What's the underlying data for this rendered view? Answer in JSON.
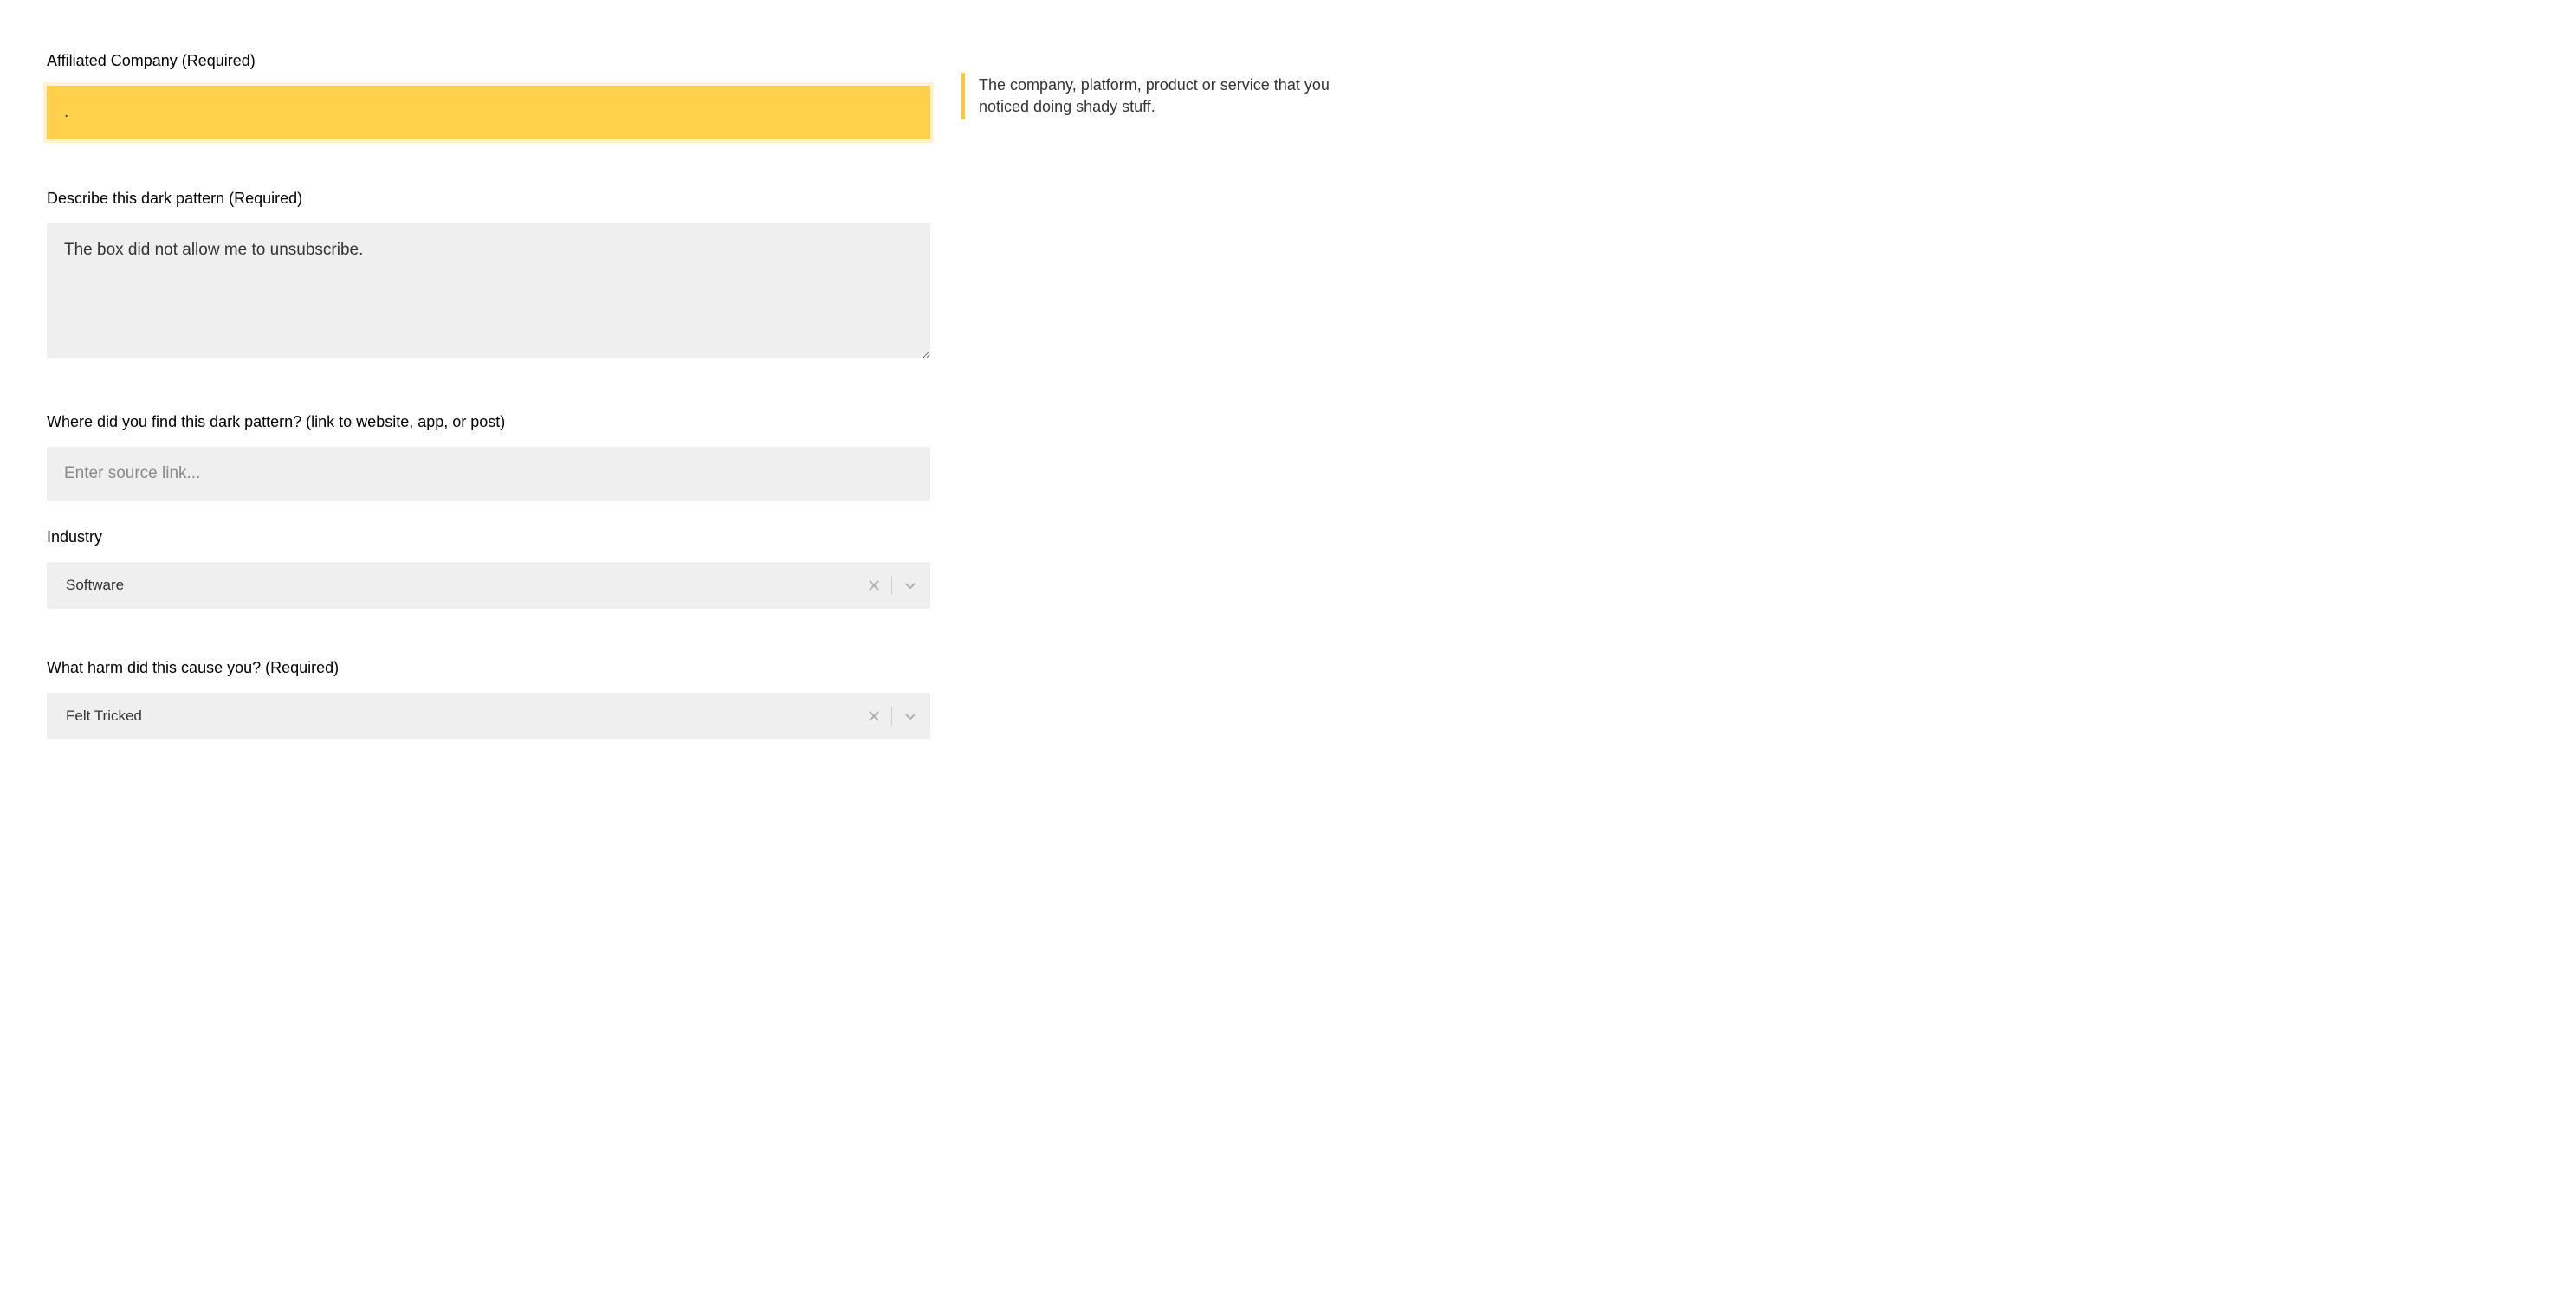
{
  "fields": {
    "company": {
      "label": "Affiliated Company (Required)",
      "value": ".",
      "help": "The company, platform, product or service that you noticed doing shady stuff."
    },
    "description": {
      "label": "Describe this dark pattern (Required)",
      "value": "The box did not allow me to unsubscribe."
    },
    "source": {
      "label": "Where did you find this dark pattern? (link to website, app, or post)",
      "placeholder": "Enter source link...",
      "value": ""
    },
    "industry": {
      "label": "Industry",
      "selected": "Software"
    },
    "harm": {
      "label": "What harm did this cause you? (Required)",
      "selected": "Felt Tricked"
    }
  }
}
